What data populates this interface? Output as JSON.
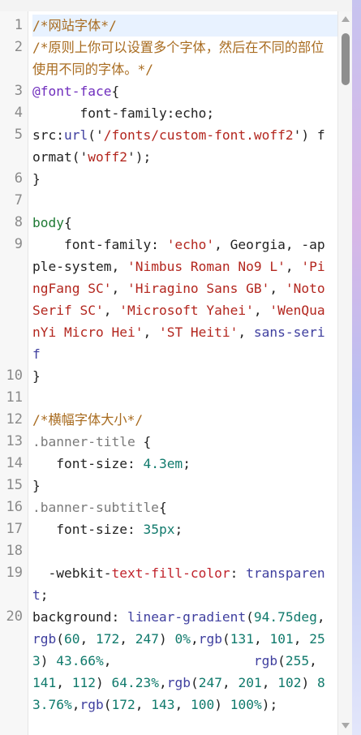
{
  "editor": {
    "lines": [
      {
        "n": "1",
        "parts": [
          {
            "c": "c",
            "t": "/*网站字体*/"
          }
        ]
      },
      {
        "n": "2",
        "parts": [
          {
            "c": "c",
            "t": "/*原则上你可以设置多个字体，然后在不同的部位使用不同的字体。*/"
          }
        ]
      },
      {
        "n": "3",
        "parts": [
          {
            "c": "kw",
            "t": "@font-face"
          },
          {
            "c": "",
            "t": "{"
          }
        ]
      },
      {
        "n": "4",
        "parts": [
          {
            "c": "",
            "t": "      font-family:echo;"
          }
        ]
      },
      {
        "n": "5",
        "parts": [
          {
            "c": "",
            "t": "src:"
          },
          {
            "c": "fn",
            "t": "url"
          },
          {
            "c": "",
            "t": "('"
          },
          {
            "c": "str",
            "t": "/fonts/custom-font.woff2"
          },
          {
            "c": "",
            "t": "') format('"
          },
          {
            "c": "str",
            "t": "woff2"
          },
          {
            "c": "",
            "t": "');"
          }
        ]
      },
      {
        "n": "6",
        "parts": [
          {
            "c": "",
            "t": "}"
          }
        ]
      },
      {
        "n": "7",
        "parts": [
          {
            "c": "",
            "t": ""
          }
        ]
      },
      {
        "n": "8",
        "parts": [
          {
            "c": "tag",
            "t": "body"
          },
          {
            "c": "",
            "t": "{"
          }
        ]
      },
      {
        "n": "9",
        "parts": [
          {
            "c": "",
            "t": "    font-family: "
          },
          {
            "c": "str",
            "t": "'echo'"
          },
          {
            "c": "",
            "t": ", Georgia, -apple-system, "
          },
          {
            "c": "str",
            "t": "'Nimbus Roman No9 L'"
          },
          {
            "c": "",
            "t": ", "
          },
          {
            "c": "str",
            "t": "'PingFang SC'"
          },
          {
            "c": "",
            "t": ", "
          },
          {
            "c": "str",
            "t": "'Hiragino Sans GB'"
          },
          {
            "c": "",
            "t": ", "
          },
          {
            "c": "str",
            "t": "'Noto Serif SC'"
          },
          {
            "c": "",
            "t": ", "
          },
          {
            "c": "str",
            "t": "'Microsoft Yahei'"
          },
          {
            "c": "",
            "t": ", "
          },
          {
            "c": "str",
            "t": "'WenQuanYi Micro Hei'"
          },
          {
            "c": "",
            "t": ", "
          },
          {
            "c": "str",
            "t": "'ST Heiti'"
          },
          {
            "c": "",
            "t": ", "
          },
          {
            "c": "fn",
            "t": "sans-serif"
          }
        ]
      },
      {
        "n": "10",
        "parts": [
          {
            "c": "",
            "t": "}"
          }
        ]
      },
      {
        "n": "11",
        "parts": [
          {
            "c": "",
            "t": ""
          }
        ]
      },
      {
        "n": "12",
        "parts": [
          {
            "c": "c",
            "t": "/*横幅字体大小*/"
          }
        ]
      },
      {
        "n": "13",
        "parts": [
          {
            "c": "sel",
            "t": ".banner-title"
          },
          {
            "c": "",
            "t": " {"
          }
        ]
      },
      {
        "n": "14",
        "parts": [
          {
            "c": "",
            "t": "   font-size: "
          },
          {
            "c": "num",
            "t": "4.3em"
          },
          {
            "c": "",
            "t": ";"
          }
        ]
      },
      {
        "n": "15",
        "parts": [
          {
            "c": "",
            "t": "}"
          }
        ]
      },
      {
        "n": "16",
        "parts": [
          {
            "c": "sel",
            "t": ".banner-subtitle"
          },
          {
            "c": "",
            "t": "{"
          }
        ]
      },
      {
        "n": "17",
        "parts": [
          {
            "c": "",
            "t": "   font-size: "
          },
          {
            "c": "num",
            "t": "35px"
          },
          {
            "c": "",
            "t": ";"
          }
        ]
      },
      {
        "n": "18",
        "parts": [
          {
            "c": "",
            "t": ""
          }
        ]
      },
      {
        "n": "19",
        "parts": [
          {
            "c": "",
            "t": "  -webkit-"
          },
          {
            "c": "prop",
            "t": "text-fill-color"
          },
          {
            "c": "",
            "t": ": "
          },
          {
            "c": "fn",
            "t": "transparent"
          },
          {
            "c": "",
            "t": ";"
          }
        ]
      },
      {
        "n": "20",
        "parts": [
          {
            "c": "",
            "t": "background: "
          },
          {
            "c": "fn",
            "t": "linear-gradient"
          },
          {
            "c": "",
            "t": "("
          },
          {
            "c": "num",
            "t": "94.75deg"
          },
          {
            "c": "",
            "t": ","
          },
          {
            "c": "fn",
            "t": "rgb"
          },
          {
            "c": "",
            "t": "("
          },
          {
            "c": "num",
            "t": "60"
          },
          {
            "c": "",
            "t": ", "
          },
          {
            "c": "num",
            "t": "172"
          },
          {
            "c": "",
            "t": ", "
          },
          {
            "c": "num",
            "t": "247"
          },
          {
            "c": "",
            "t": ") "
          },
          {
            "c": "num",
            "t": "0%"
          },
          {
            "c": "",
            "t": ","
          },
          {
            "c": "fn",
            "t": "rgb"
          },
          {
            "c": "",
            "t": "("
          },
          {
            "c": "num",
            "t": "131"
          },
          {
            "c": "",
            "t": ", "
          },
          {
            "c": "num",
            "t": "101"
          },
          {
            "c": "",
            "t": ", "
          },
          {
            "c": "num",
            "t": "253"
          },
          {
            "c": "",
            "t": ") "
          },
          {
            "c": "num",
            "t": "43.66%"
          },
          {
            "c": "",
            "t": ",                  "
          },
          {
            "c": "fn",
            "t": "rgb"
          },
          {
            "c": "",
            "t": "("
          },
          {
            "c": "num",
            "t": "255"
          },
          {
            "c": "",
            "t": ", "
          },
          {
            "c": "num",
            "t": "141"
          },
          {
            "c": "",
            "t": ", "
          },
          {
            "c": "num",
            "t": "112"
          },
          {
            "c": "",
            "t": ") "
          },
          {
            "c": "num",
            "t": "64.23%"
          },
          {
            "c": "",
            "t": ","
          },
          {
            "c": "fn",
            "t": "rgb"
          },
          {
            "c": "",
            "t": "("
          },
          {
            "c": "num",
            "t": "247"
          },
          {
            "c": "",
            "t": ", "
          },
          {
            "c": "num",
            "t": "201"
          },
          {
            "c": "",
            "t": ", "
          },
          {
            "c": "num",
            "t": "102"
          },
          {
            "c": "",
            "t": ") "
          },
          {
            "c": "num",
            "t": "83.76%"
          },
          {
            "c": "",
            "t": ","
          },
          {
            "c": "fn",
            "t": "rgb"
          },
          {
            "c": "",
            "t": "("
          },
          {
            "c": "num",
            "t": "172"
          },
          {
            "c": "",
            "t": ", "
          },
          {
            "c": "num",
            "t": "143"
          },
          {
            "c": "",
            "t": ", "
          },
          {
            "c": "num",
            "t": "100"
          },
          {
            "c": "",
            "t": ") "
          },
          {
            "c": "num",
            "t": "100%"
          },
          {
            "c": "",
            "t": ");"
          }
        ]
      }
    ],
    "active_line": "1"
  },
  "scrollbar": {
    "up_icon": "arrow-up-icon",
    "down_icon": "arrow-down-icon"
  },
  "colors": {
    "comment": "#a86b1f",
    "keyword": "#6f2dbd",
    "string": "#b3261e",
    "number": "#107a6c",
    "function": "#3f3f9f",
    "active_line": "#e8f2ff"
  }
}
